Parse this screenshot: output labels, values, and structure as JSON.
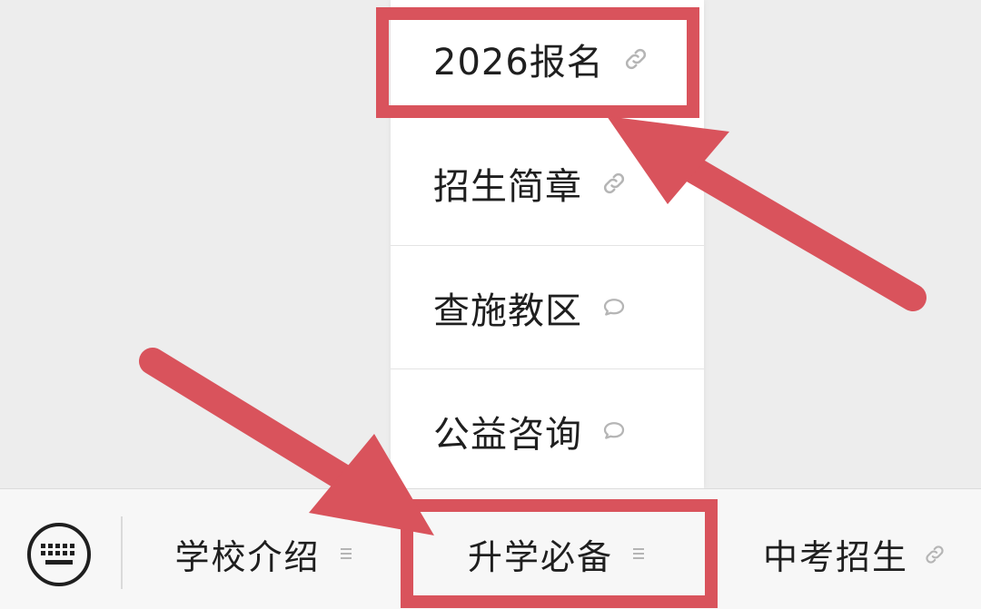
{
  "menu": {
    "items": [
      {
        "label": "2026报名",
        "icon": "link-icon"
      },
      {
        "label": "招生简章",
        "icon": "link-icon"
      },
      {
        "label": "查施教区",
        "icon": "speech-bubble-icon"
      },
      {
        "label": "公益咨询",
        "icon": "speech-bubble-icon"
      }
    ]
  },
  "bottom_bar": {
    "keyboard_icon": "keyboard-icon",
    "tabs": [
      {
        "label": "学校介绍",
        "icon": "menu-lines-icon"
      },
      {
        "label": "升学必备",
        "icon": "menu-lines-icon"
      },
      {
        "label": "中考招生",
        "icon": "link-icon"
      }
    ]
  },
  "colors": {
    "highlight": "#d9535c",
    "background": "#ededed",
    "menu_background": "#ffffff",
    "bar_background": "#f7f7f7",
    "text": "#1f1f1f",
    "icon_gray": "#b5b5b5"
  }
}
